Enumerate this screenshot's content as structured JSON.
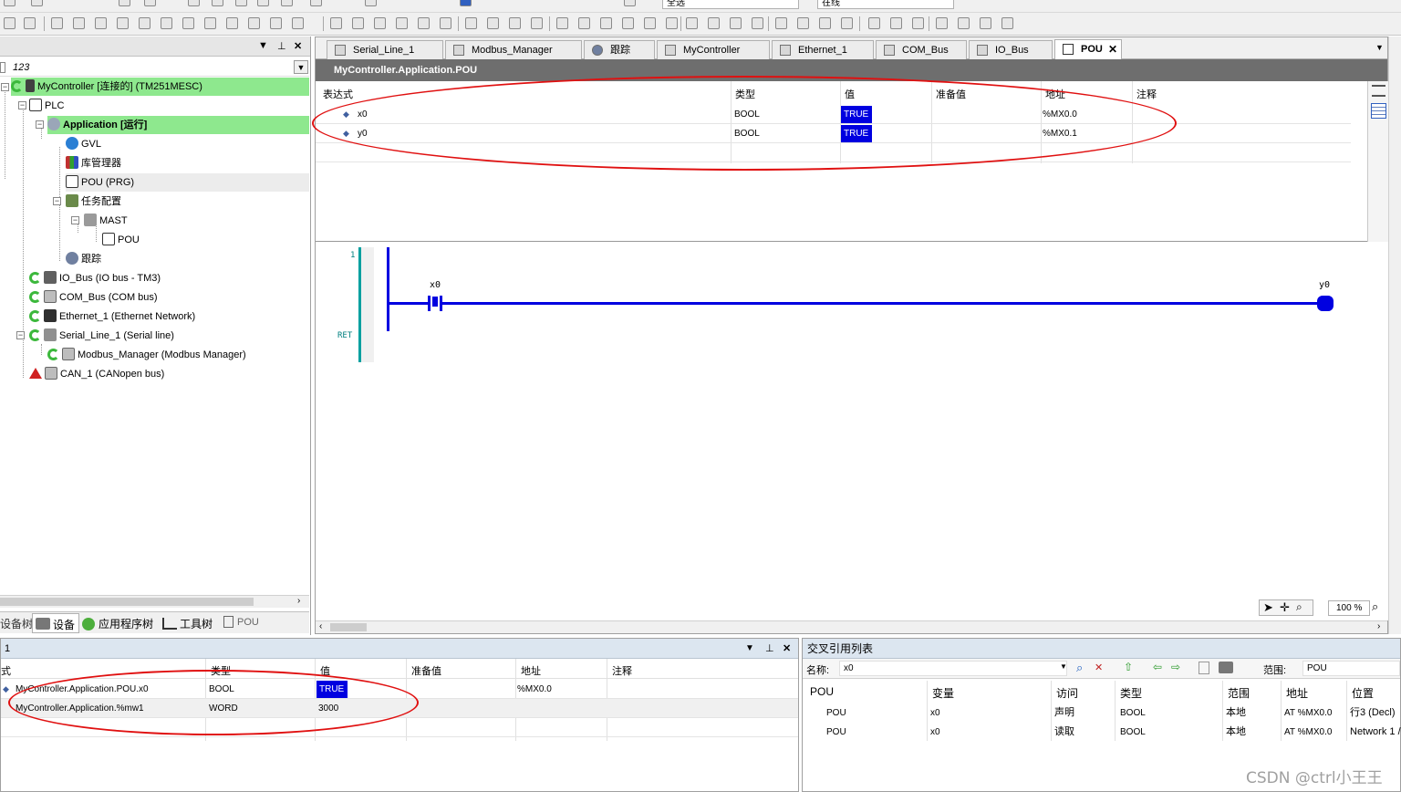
{
  "toolbar": {
    "dropdown1": "全选",
    "dropdown2": "在线"
  },
  "device_tree": {
    "root": "123",
    "items": [
      {
        "label": "MyController [连接的] (TM251MESC)"
      },
      {
        "label": "PLC"
      },
      {
        "label": "Application [运行]"
      },
      {
        "label": "GVL"
      },
      {
        "label": "库管理器"
      },
      {
        "label": "POU (PRG)"
      },
      {
        "label": "任务配置"
      },
      {
        "label": "MAST"
      },
      {
        "label": "POU"
      },
      {
        "label": "跟踪"
      },
      {
        "label": "IO_Bus (IO bus - TM3)"
      },
      {
        "label": "COM_Bus (COM bus)"
      },
      {
        "label": "Ethernet_1 (Ethernet Network)"
      },
      {
        "label": "Serial_Line_1 (Serial line)"
      },
      {
        "label": "Modbus_Manager (Modbus Manager)"
      },
      {
        "label": "CAN_1 (CANopen bus)"
      }
    ],
    "bottom_tabs": [
      "设备树",
      "设备",
      "应用程序树",
      "工具树",
      "POU"
    ]
  },
  "editor": {
    "tabs": [
      "Serial_Line_1",
      "Modbus_Manager",
      "跟踪",
      "MyController",
      "Ethernet_1",
      "COM_Bus",
      "IO_Bus",
      "POU"
    ],
    "active_tab": "POU",
    "title": "MyController.Application.POU",
    "watch_headers": [
      "表达式",
      "类型",
      "值",
      "准备值",
      "地址",
      "注释"
    ],
    "watch_rows": [
      {
        "expr": "x0",
        "type": "BOOL",
        "value": "TRUE",
        "addr": "%MX0.0"
      },
      {
        "expr": "y0",
        "type": "BOOL",
        "value": "TRUE",
        "addr": "%MX0.1"
      }
    ],
    "ladder": {
      "line_no": "1",
      "ret": "RET",
      "contact": "x0",
      "coil": "y0"
    },
    "zoom": "100 %"
  },
  "watch_panel": {
    "title": "1",
    "headers": [
      "式",
      "类型",
      "值",
      "准备值",
      "地址",
      "注释"
    ],
    "rows": [
      {
        "expr": "MyController.Application.POU.x0",
        "type": "BOOL",
        "value": "TRUE",
        "addr": "%MX0.0"
      },
      {
        "expr": "MyController.Application.%mw1",
        "type": "WORD",
        "value": "3000",
        "addr": ""
      }
    ]
  },
  "xref_panel": {
    "title": "交叉引用列表",
    "name_label": "名称:",
    "name_value": "x0",
    "scope_label": "范围:",
    "scope_value": "POU",
    "headers": [
      "POU",
      "变量",
      "访问",
      "类型",
      "范围",
      "地址",
      "位置"
    ],
    "rows": [
      {
        "pou": "POU",
        "var": "x0",
        "access": "声明",
        "type": "BOOL",
        "scope": "本地",
        "addr": "AT %MX0.0",
        "loc": "行3 (Decl)"
      },
      {
        "pou": "POU",
        "var": "x0",
        "access": "读取",
        "type": "BOOL",
        "scope": "本地",
        "addr": "AT %MX0.0",
        "loc": "Network 1 /"
      }
    ]
  },
  "watermark": "CSDN @ctrl小王王",
  "colors": {
    "online_green": "#8ee88e",
    "true_blue": "#0000e0",
    "rung_blue": "#0000e0",
    "annotation_red": "#e01010"
  }
}
